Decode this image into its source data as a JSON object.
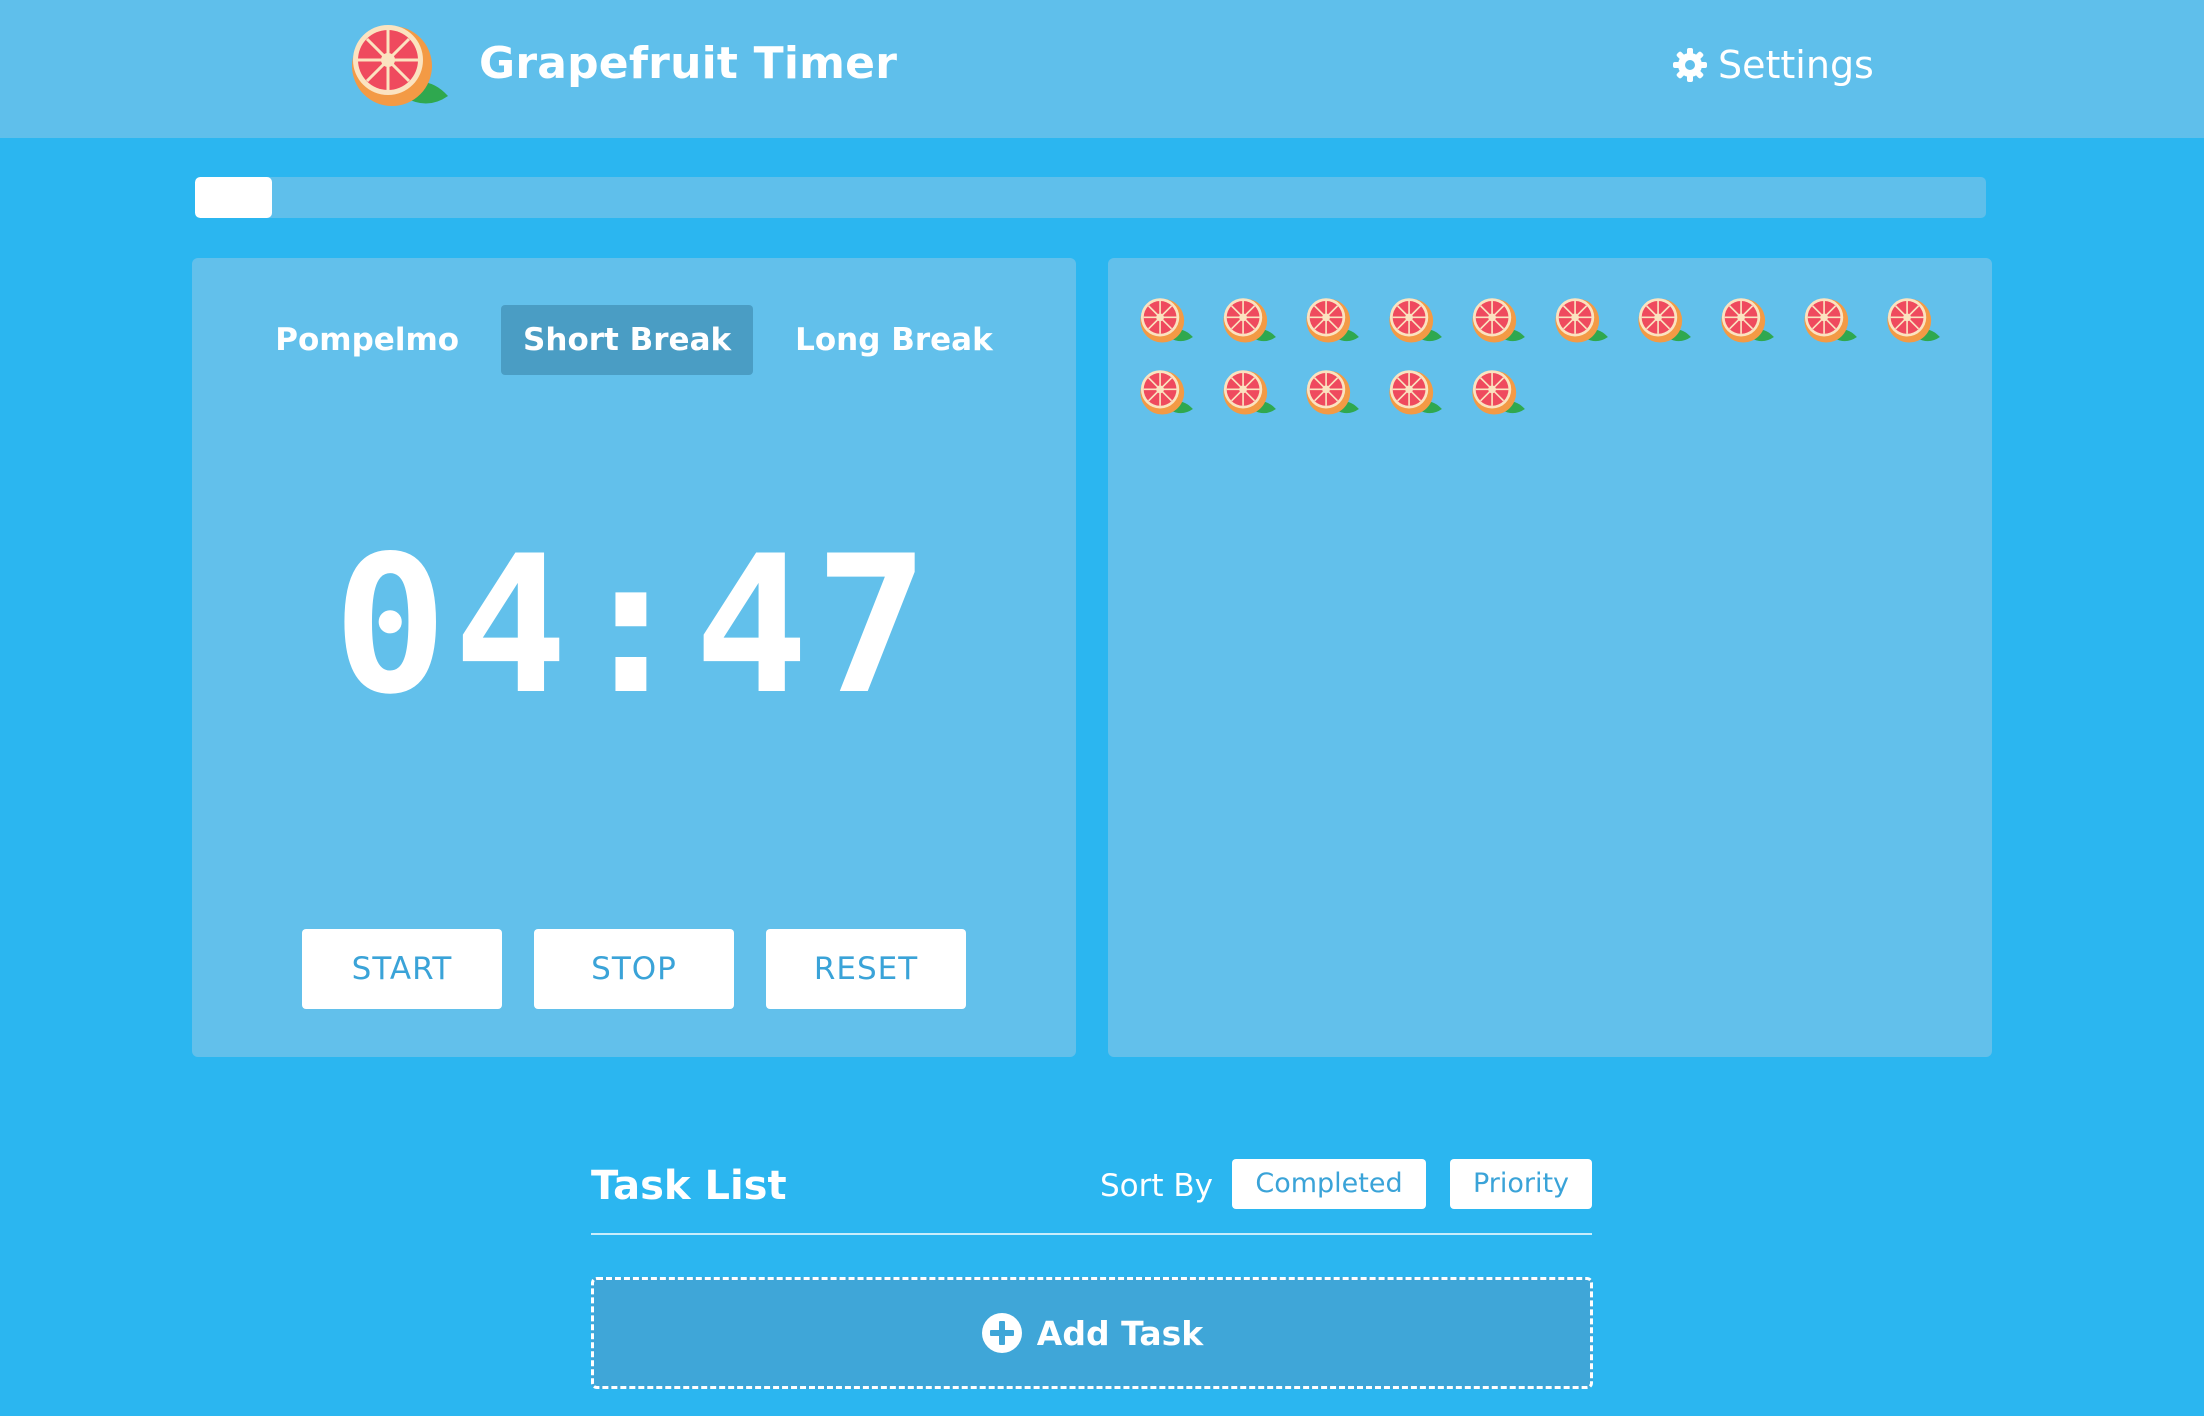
{
  "header": {
    "logo_icon": "grapefruit-icon",
    "title": "Grapefruit Timer",
    "settings_icon": "gear-icon",
    "settings_label": "Settings"
  },
  "progress": {
    "fraction": 0.043
  },
  "timer": {
    "modes": [
      "Pompelmo",
      "Short Break",
      "Long Break"
    ],
    "active_mode": "Short Break",
    "display": "04:47",
    "buttons": {
      "start": "START",
      "stop": "STOP",
      "reset": "RESET"
    }
  },
  "completed_pomodoros": {
    "count": 15,
    "icon": "grapefruit-icon"
  },
  "tasks": {
    "title": "Task List",
    "sort_label": "Sort By",
    "sort_options": {
      "completed": "Completed",
      "priority": "Priority"
    },
    "add_icon": "plus-circle-icon",
    "add_label": "Add Task"
  },
  "colors": {
    "background": "#2bb6f0",
    "panel": "#62c0eb",
    "active_tab": "#4a9dc4",
    "button_text": "#3aa3d8"
  }
}
